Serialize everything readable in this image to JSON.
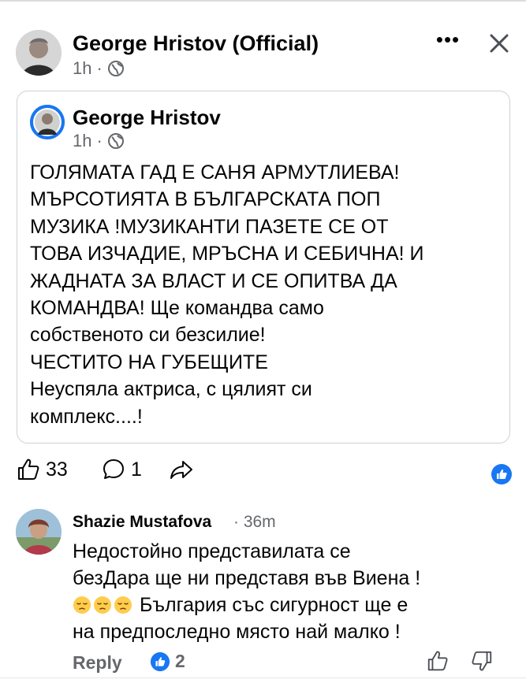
{
  "post": {
    "author": "George Hristov (Official)",
    "time": "1h",
    "separator": "·",
    "more_label": "•••",
    "icons": {
      "menu": "more-horizontal-icon",
      "close": "close-icon",
      "privacy": "globe-icon"
    }
  },
  "shared": {
    "author": "George Hristov",
    "time": "1h",
    "separator": "·",
    "lines": [
      "ГОЛЯМАТА ГАД Е САНЯ АРМУТЛИЕВА!",
      "МЪРСОТИЯТА В БЪЛГАРСКАТА ПОП",
      "МУЗИКА !МУЗИКАНТИ  ПАЗЕТЕ СЕ ОТ",
      "ТОВА  ИЗЧАДИЕ, МРЪСНА И СЕБИЧНА! И",
      "ЖАДНАТА ЗА ВЛАСТ И   СЕ ОПИТВА  ДА",
      "КОМАНДВА! Ще командва само",
      "собственото си безсилие!",
      "ЧЕСТИТО НА ГУБЕЩИТЕ",
      "Неуспяла актриса, с цялият си",
      "комплекс....!"
    ]
  },
  "actions": {
    "likes": "33",
    "comments": "1",
    "icons": {
      "like": "thumbs-up-icon",
      "comment": "comment-icon",
      "share": "share-icon",
      "reaction": "like-reaction-icon"
    },
    "colors": {
      "reaction": "#1877f2"
    }
  },
  "comment": {
    "author": "Shazie Mustafova",
    "time": "· 36m",
    "lines": [
      "Недостойно представилата се",
      "безДара  ще ни представя във Виена !"
    ],
    "emoji_line_text": " България със сигурност ще е",
    "emoji": [
      "pensive-face-icon",
      "pensive-face-icon",
      "pensive-face-icon"
    ],
    "last_line": "на предпоследно място най малко !",
    "reply_label": "Reply",
    "reaction_count": "2",
    "icons": {
      "like": "thumbs-up-icon",
      "dislike": "thumbs-down-icon"
    }
  }
}
